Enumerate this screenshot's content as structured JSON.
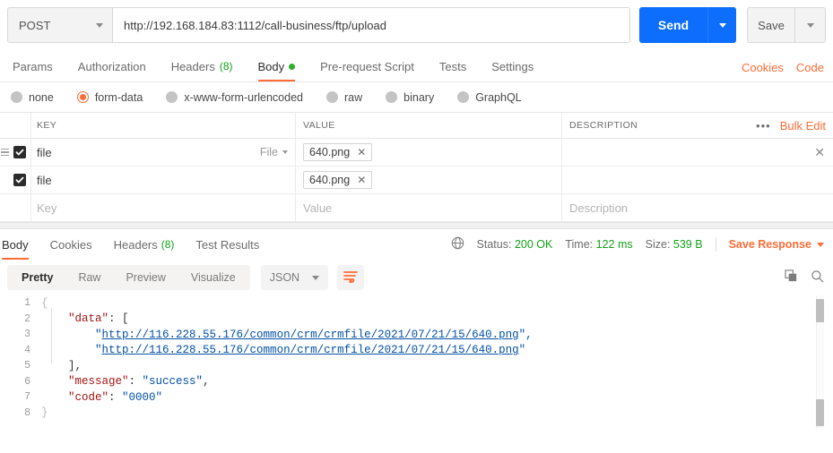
{
  "request": {
    "method": "POST",
    "url": "http://192.168.184.83:1112/call-business/ftp/upload",
    "send_label": "Send",
    "save_label": "Save",
    "tabs": [
      {
        "label": "Params",
        "count": "",
        "active": false,
        "dot": false
      },
      {
        "label": "Authorization",
        "count": "",
        "active": false,
        "dot": false
      },
      {
        "label": "Headers",
        "count": "(8)",
        "active": false,
        "dot": false
      },
      {
        "label": "Body",
        "count": "",
        "active": true,
        "dot": true
      },
      {
        "label": "Pre-request Script",
        "count": "",
        "active": false,
        "dot": false
      },
      {
        "label": "Tests",
        "count": "",
        "active": false,
        "dot": false
      },
      {
        "label": "Settings",
        "count": "",
        "active": false,
        "dot": false
      }
    ],
    "cookies_link": "Cookies",
    "code_link": "Code"
  },
  "body_types": [
    {
      "label": "none",
      "selected": false
    },
    {
      "label": "form-data",
      "selected": true
    },
    {
      "label": "x-www-form-urlencoded",
      "selected": false
    },
    {
      "label": "raw",
      "selected": false
    },
    {
      "label": "binary",
      "selected": false
    },
    {
      "label": "GraphQL",
      "selected": false
    }
  ],
  "form_table": {
    "headers": {
      "key": "KEY",
      "value": "VALUE",
      "description": "DESCRIPTION"
    },
    "bulk_edit": "Bulk Edit",
    "more_dots": "•••",
    "rows": [
      {
        "checked": true,
        "key": "file",
        "type": "File",
        "value": "640.png",
        "description": "",
        "has_handle": true,
        "has_delete": true
      },
      {
        "checked": true,
        "key": "file",
        "type": "",
        "value": "640.png",
        "description": "",
        "has_handle": false,
        "has_delete": false
      }
    ],
    "placeholder_row": {
      "key": "Key",
      "value": "Value",
      "description": "Description"
    }
  },
  "response": {
    "tabs": [
      {
        "label": "Body",
        "count": "",
        "active": true
      },
      {
        "label": "Cookies",
        "count": "",
        "active": false
      },
      {
        "label": "Headers",
        "count": "(8)",
        "active": false
      },
      {
        "label": "Test Results",
        "count": "",
        "active": false
      }
    ],
    "status_label": "Status:",
    "status_value": "200 OK",
    "time_label": "Time:",
    "time_value": "122 ms",
    "size_label": "Size:",
    "size_value": "539 B",
    "save_response": "Save Response",
    "view_modes": [
      {
        "label": "Pretty",
        "active": true
      },
      {
        "label": "Raw",
        "active": false
      },
      {
        "label": "Preview",
        "active": false
      },
      {
        "label": "Visualize",
        "active": false
      }
    ],
    "format": "JSON",
    "code_lines": [
      {
        "n": "1",
        "indent": 0,
        "tokens": [
          {
            "t": "{",
            "c": "fold"
          }
        ]
      },
      {
        "n": "2",
        "indent": 1,
        "tokens": [
          {
            "t": "\"data\"",
            "c": "k"
          },
          {
            "t": ": [",
            "c": "p"
          }
        ]
      },
      {
        "n": "3",
        "indent": 2,
        "tokens": [
          {
            "t": "\"",
            "c": "s"
          },
          {
            "t": "http://116.228.55.176/common/crm/crmfile/2021/07/21/15/640.png",
            "c": "lnk"
          },
          {
            "t": "\",",
            "c": "s"
          }
        ]
      },
      {
        "n": "4",
        "indent": 2,
        "tokens": [
          {
            "t": "\"",
            "c": "s"
          },
          {
            "t": "http://116.228.55.176/common/crm/crmfile/2021/07/21/15/640.png",
            "c": "lnk"
          },
          {
            "t": "\"",
            "c": "s"
          }
        ]
      },
      {
        "n": "5",
        "indent": 1,
        "tokens": [
          {
            "t": "],",
            "c": "p"
          }
        ]
      },
      {
        "n": "6",
        "indent": 1,
        "tokens": [
          {
            "t": "\"message\"",
            "c": "k"
          },
          {
            "t": ": ",
            "c": "p"
          },
          {
            "t": "\"success\"",
            "c": "s"
          },
          {
            "t": ",",
            "c": "p"
          }
        ]
      },
      {
        "n": "7",
        "indent": 1,
        "tokens": [
          {
            "t": "\"code\"",
            "c": "k"
          },
          {
            "t": ": ",
            "c": "p"
          },
          {
            "t": "\"0000\"",
            "c": "s"
          }
        ]
      },
      {
        "n": "8",
        "indent": 0,
        "tokens": [
          {
            "t": "}",
            "c": "fold"
          }
        ]
      }
    ]
  },
  "colors": {
    "accent_orange": "#ff6c37",
    "send_blue": "#0d6efd",
    "status_green": "#13a418",
    "json_key": "#a31515",
    "json_string": "#0451a5"
  }
}
